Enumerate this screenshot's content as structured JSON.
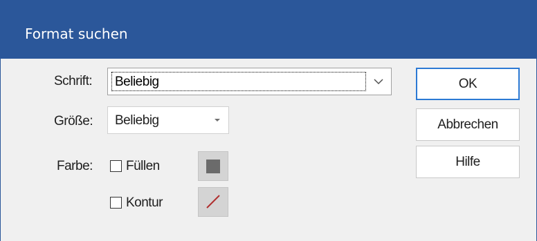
{
  "window": {
    "title": "Format suchen"
  },
  "form": {
    "font_label": "Schrift:",
    "font_value": "Beliebig",
    "size_label": "Größe:",
    "size_value": "Beliebig",
    "color_label": "Farbe:",
    "fill_checkbox_label": "Füllen",
    "fill_checked": false,
    "outline_checkbox_label": "Kontur",
    "outline_checked": false,
    "fill_swatch_color": "#6b6b6b",
    "outline_swatch": "none-slash",
    "slash_color": "#b03030"
  },
  "buttons": {
    "ok": "OK",
    "cancel": "Abbrechen",
    "help": "Hilfe"
  },
  "colors": {
    "titlebar": "#2b579a",
    "dialog_bg": "#f0f0f0",
    "default_button_border": "#2b79d4"
  }
}
